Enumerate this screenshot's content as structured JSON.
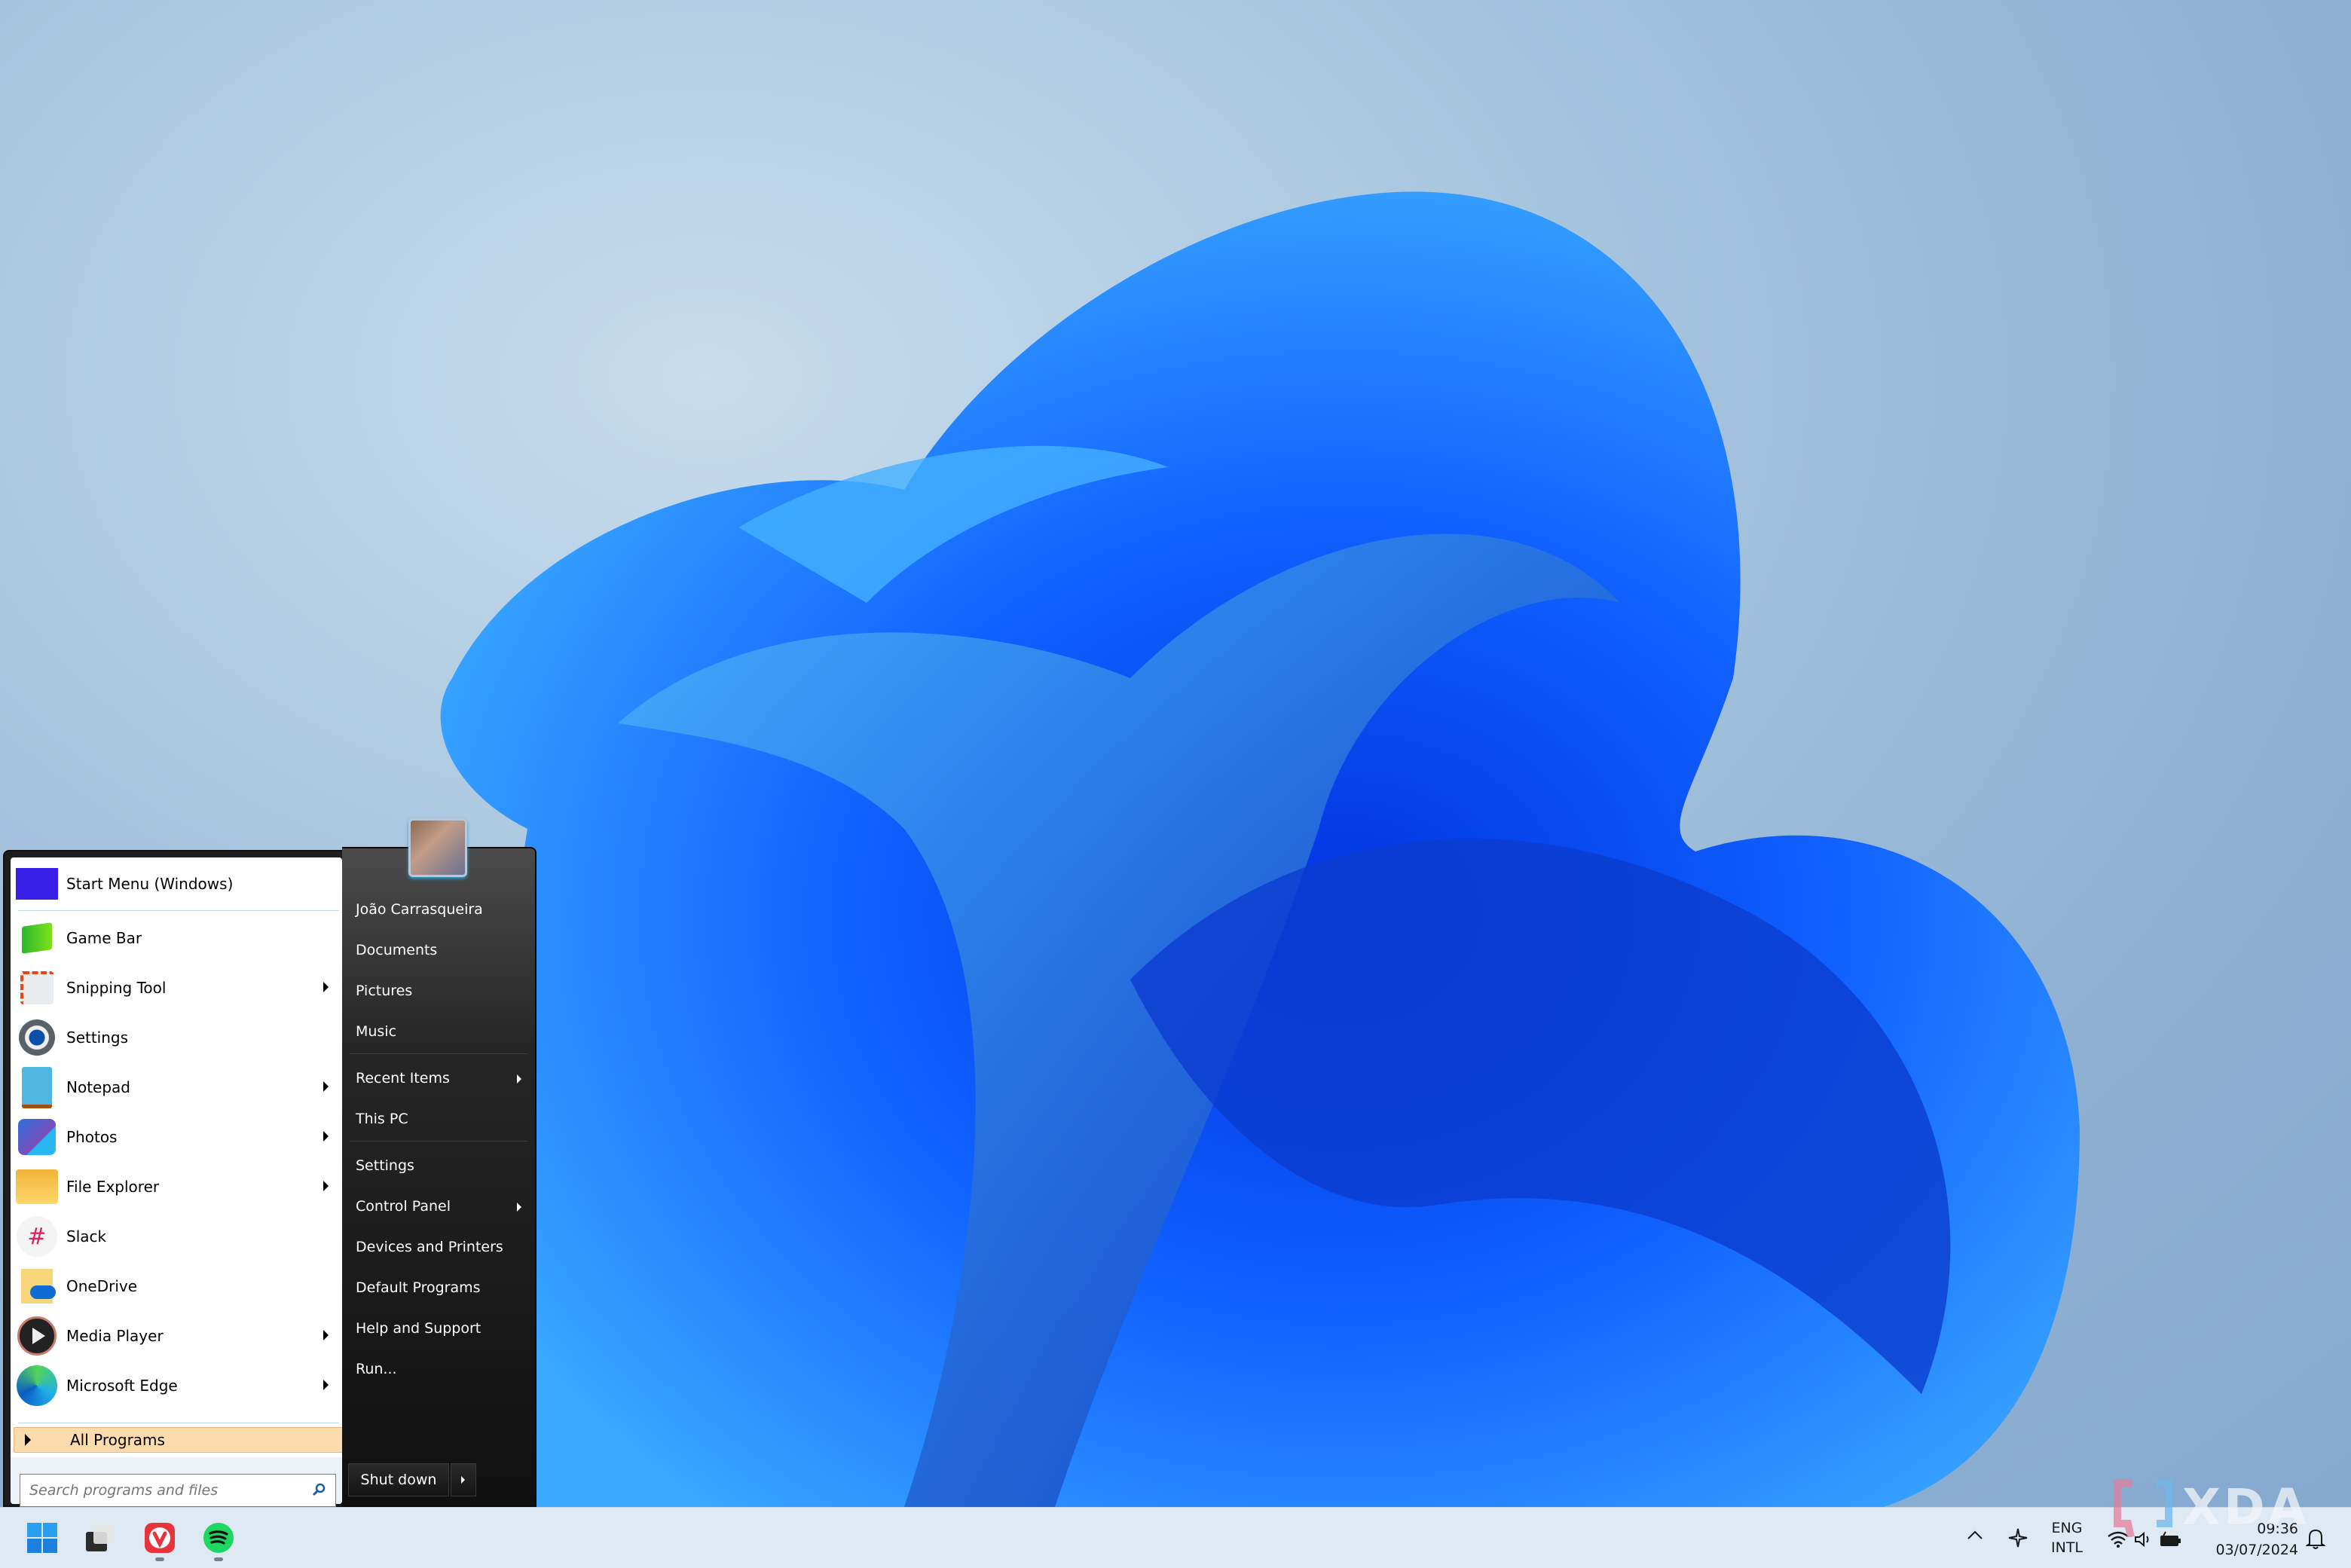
{
  "start_menu": {
    "pinned": [
      {
        "label": "Start Menu (Windows)",
        "icon": "start-menu-app-icon",
        "submenu": false
      },
      {
        "label": "Game Bar",
        "icon": "game-bar-icon",
        "submenu": false
      },
      {
        "label": "Snipping Tool",
        "icon": "snipping-tool-icon",
        "submenu": true
      },
      {
        "label": "Settings",
        "icon": "settings-gear-icon",
        "submenu": false
      },
      {
        "label": "Notepad",
        "icon": "notepad-icon",
        "submenu": true
      },
      {
        "label": "Photos",
        "icon": "photos-icon",
        "submenu": true
      },
      {
        "label": "File Explorer",
        "icon": "folder-icon",
        "submenu": true
      },
      {
        "label": "Slack",
        "icon": "slack-icon",
        "submenu": false
      },
      {
        "label": "OneDrive",
        "icon": "onedrive-icon",
        "submenu": false
      },
      {
        "label": "Media Player",
        "icon": "media-player-icon",
        "submenu": true
      },
      {
        "label": "Microsoft Edge",
        "icon": "edge-icon",
        "submenu": true
      }
    ],
    "all_programs_label": "All Programs",
    "search_placeholder": "Search programs and files",
    "user_name": "João Carrasqueira",
    "right_links": [
      {
        "label": "Documents"
      },
      {
        "label": "Pictures"
      },
      {
        "label": "Music"
      },
      {
        "label": "Recent Items",
        "submenu": true
      },
      {
        "label": "This PC"
      },
      {
        "label": "Settings"
      },
      {
        "label": "Control Panel",
        "submenu": true,
        "accel": "C"
      },
      {
        "label": "Devices and Printers"
      },
      {
        "label": "Default Programs"
      },
      {
        "label": "Help and Support",
        "accel": "H"
      },
      {
        "label": "Run...",
        "accel": "R"
      }
    ],
    "shutdown_label": "Shut down"
  },
  "taskbar": {
    "apps": [
      {
        "name": "Start",
        "icon": "windows-logo-icon"
      },
      {
        "name": "Task View",
        "icon": "task-view-icon"
      },
      {
        "name": "Vivaldi",
        "icon": "vivaldi-icon",
        "running": true
      },
      {
        "name": "Spotify",
        "icon": "spotify-icon",
        "running": true
      }
    ],
    "tray": {
      "language_line1": "ENG",
      "language_line2": "INTL",
      "time": "09:36",
      "date": "03/07/2024"
    }
  },
  "watermark": "XDA",
  "colors": {
    "all_programs_highlight": "#fcdcad",
    "right_panel": "#1e1e1e",
    "taskbar": "#dfe9f4"
  }
}
